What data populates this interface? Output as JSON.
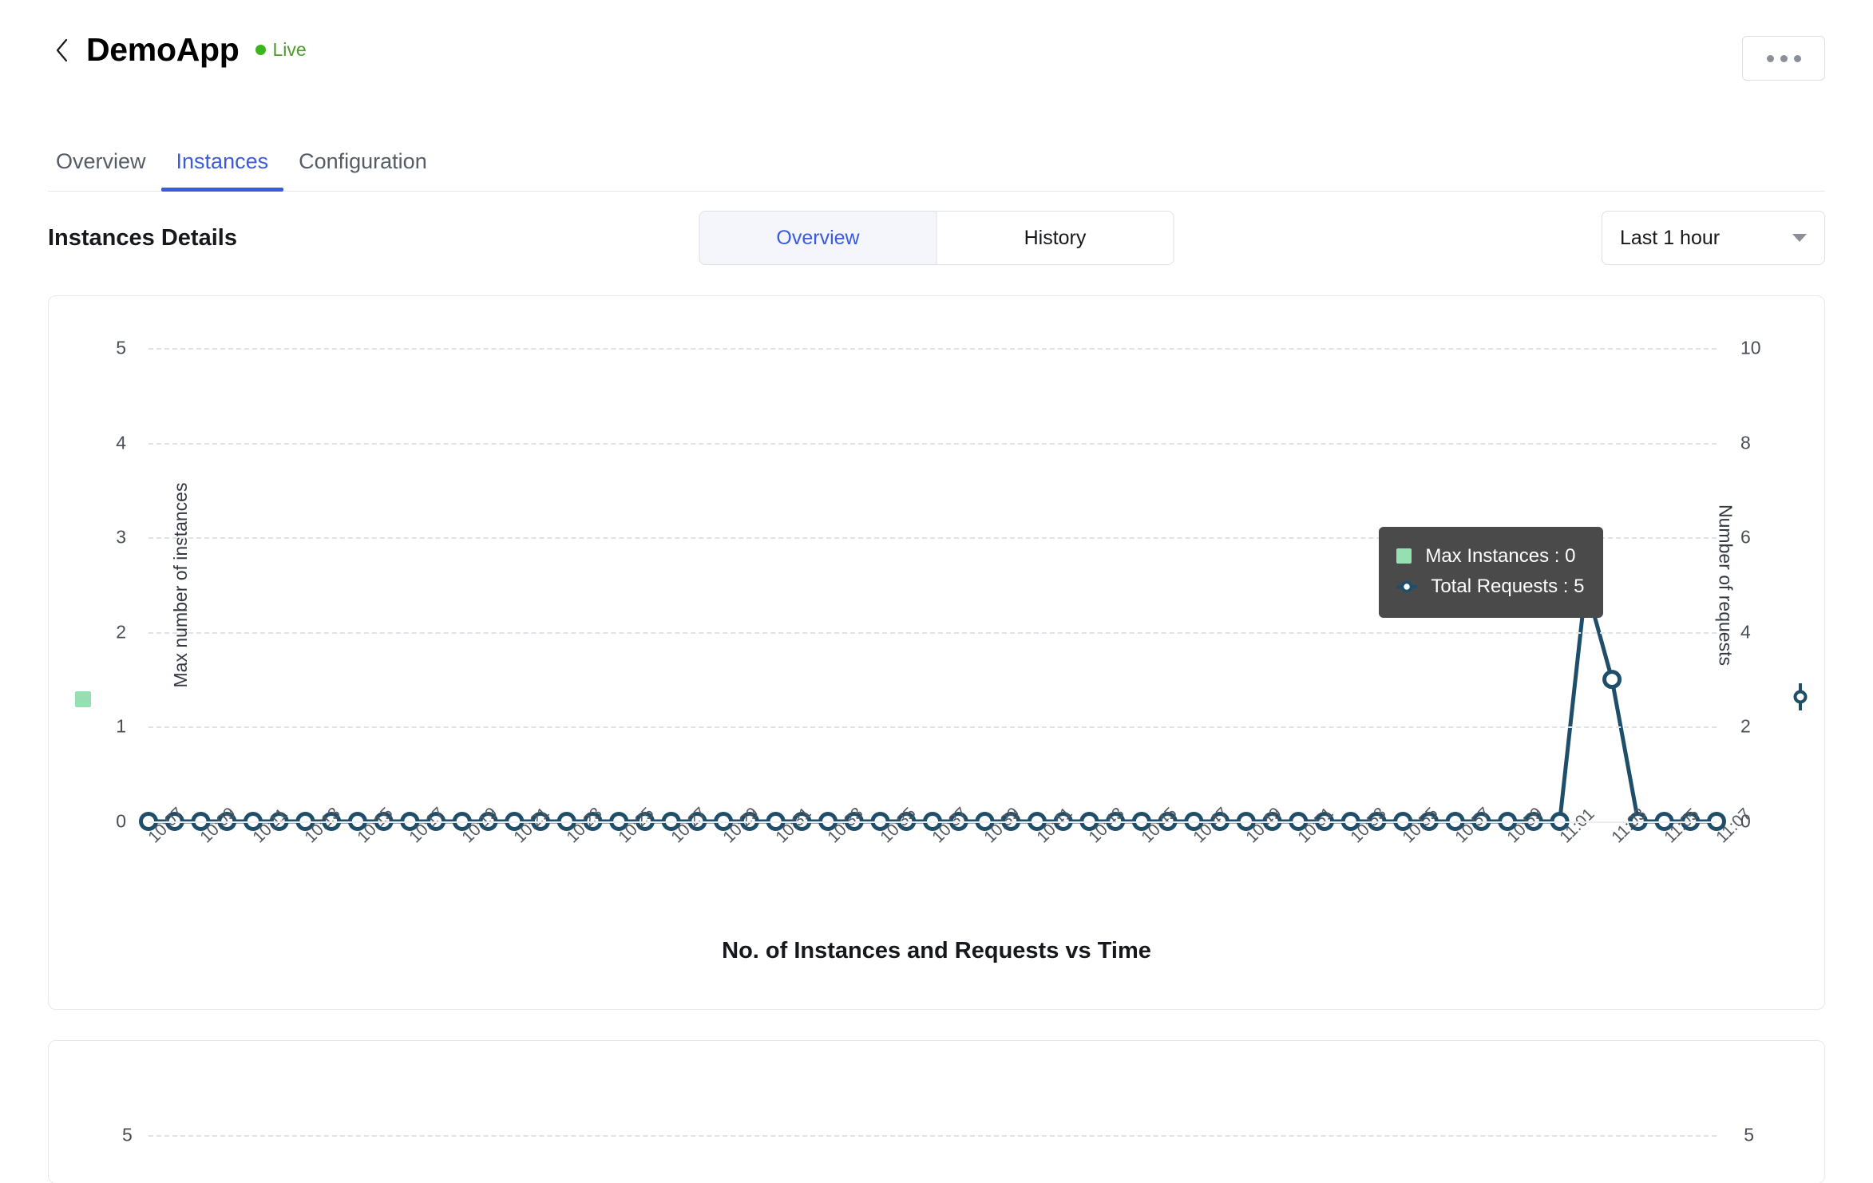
{
  "header": {
    "back_icon": "chevron-left-icon",
    "title": "DemoApp",
    "status_label": "Live",
    "status_color": "#4d9b2a",
    "menu_icon": "ellipsis-icon"
  },
  "tabs": [
    {
      "label": "Overview",
      "active": false
    },
    {
      "label": "Instances",
      "active": true
    },
    {
      "label": "Configuration",
      "active": false
    }
  ],
  "toolbar": {
    "section_title": "Instances Details",
    "segmented": [
      {
        "label": "Overview",
        "active": true
      },
      {
        "label": "History",
        "active": false
      }
    ],
    "range": {
      "value": "Last 1 hour",
      "caret_icon": "chevron-down-icon"
    }
  },
  "tooltip": {
    "rows": [
      {
        "marker": "square",
        "color": "#96dfb0",
        "text": "Max Instances : 0"
      },
      {
        "marker": "line-dot",
        "color": "#1f4e6b",
        "text": "Total Requests : 5"
      }
    ]
  },
  "chart_data": {
    "type": "line",
    "title": "No. of Instances and Requests vs Time",
    "xlabel": "",
    "ylabel": "Max number of instances",
    "y2label": "Number of requests",
    "ylim": [
      0,
      5
    ],
    "y2lim": [
      0,
      10
    ],
    "yticks": [
      0,
      1,
      2,
      3,
      4,
      5
    ],
    "y2ticks": [
      0,
      2,
      4,
      6,
      8,
      10
    ],
    "grid": true,
    "legend": [
      {
        "name": "Max Instances",
        "color": "#96dfb0",
        "marker": "square"
      },
      {
        "name": "Total Requests",
        "color": "#1f4e6b",
        "marker": "circle"
      }
    ],
    "x": [
      "10:07",
      "10:08",
      "10:09",
      "10:10",
      "10:11",
      "10:12",
      "10:13",
      "10:14",
      "10:15",
      "10:16",
      "10:17",
      "10:18",
      "10:19",
      "10:20",
      "10:21",
      "10:22",
      "10:23",
      "10:24",
      "10:25",
      "10:26",
      "10:27",
      "10:28",
      "10:29",
      "10:30",
      "10:31",
      "10:32",
      "10:33",
      "10:34",
      "10:35",
      "10:36",
      "10:37",
      "10:38",
      "10:39",
      "10:40",
      "10:41",
      "10:42",
      "10:43",
      "10:44",
      "10:45",
      "10:46",
      "10:47",
      "10:48",
      "10:49",
      "10:50",
      "10:51",
      "10:52",
      "10:53",
      "10:54",
      "10:55",
      "10:56",
      "10:57",
      "10:58",
      "10:59",
      "11:00",
      "11:01",
      "11:02",
      "11:03",
      "11:04",
      "11:05",
      "11:06",
      "11:07"
    ],
    "xtick_labels": [
      "10:07",
      "10:09",
      "10:11",
      "10:13",
      "10:15",
      "10:17",
      "10:19",
      "10:21",
      "10:23",
      "10:25",
      "10:27",
      "10:29",
      "10:31",
      "10:33",
      "10:35",
      "10:37",
      "10:39",
      "10:41",
      "10:43",
      "10:45",
      "10:47",
      "10:49",
      "10:51",
      "10:53",
      "10:55",
      "10:57",
      "10:59",
      "11:01",
      "11:03",
      "11:05",
      "11:07"
    ],
    "series": [
      {
        "name": "Max Instances",
        "axis": "left",
        "color": "#96dfb0",
        "values": [
          0,
          0,
          0,
          0,
          0,
          0,
          0,
          0,
          0,
          0,
          0,
          0,
          0,
          0,
          0,
          0,
          0,
          0,
          0,
          0,
          0,
          0,
          0,
          0,
          0,
          0,
          0,
          0,
          0,
          0,
          0,
          0,
          0,
          0,
          0,
          0,
          0,
          0,
          0,
          0,
          0,
          0,
          0,
          0,
          0,
          0,
          0,
          0,
          0,
          0,
          0,
          0,
          0,
          0,
          0,
          0,
          0,
          0,
          0,
          0,
          0
        ]
      },
      {
        "name": "Total Requests",
        "axis": "right",
        "color": "#1f4e6b",
        "values": [
          0,
          0,
          0,
          0,
          0,
          0,
          0,
          0,
          0,
          0,
          0,
          0,
          0,
          0,
          0,
          0,
          0,
          0,
          0,
          0,
          0,
          0,
          0,
          0,
          0,
          0,
          0,
          0,
          0,
          0,
          0,
          0,
          0,
          0,
          0,
          0,
          0,
          0,
          0,
          0,
          0,
          0,
          0,
          0,
          0,
          0,
          0,
          0,
          0,
          0,
          0,
          0,
          0,
          0,
          0,
          5,
          3,
          0,
          0,
          0,
          0
        ]
      }
    ],
    "highlight_index": 55
  },
  "chart_data_secondary": {
    "type": "line",
    "yticks_left": [
      5
    ],
    "yticks_right": [
      5
    ],
    "grid": true
  }
}
